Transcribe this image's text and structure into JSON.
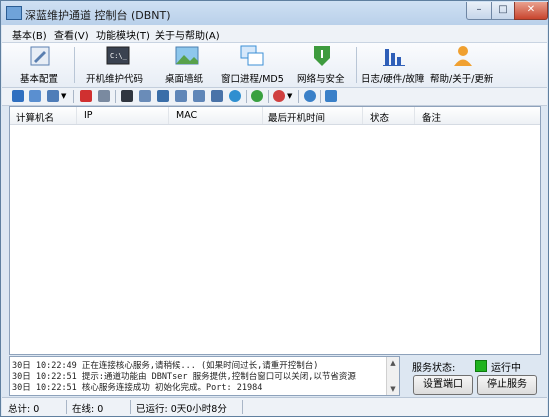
{
  "window": {
    "title": "深蓝维护通道 控制台 (DBNT)"
  },
  "menu": [
    "基本(B)",
    "查看(V)",
    "功能模块(T)",
    "关于与帮助(A)"
  ],
  "toolbar": [
    {
      "label": "基本配置",
      "icon": "settings-icon",
      "color": "#5a7fb0"
    },
    {
      "label": "开机维护代码",
      "icon": "terminal-icon",
      "color": "#3a4250"
    },
    {
      "label": "桌面墙纸",
      "icon": "wallpaper-icon",
      "color": "#58a14b"
    },
    {
      "label": "窗口进程/MD5",
      "icon": "windows-icon",
      "color": "#3b8fd6"
    },
    {
      "label": "网络与安全",
      "icon": "shield-icon",
      "color": "#3e9b3e"
    },
    {
      "label": "日志/硬件/故障",
      "icon": "bar-chart-icon",
      "color": "#2f5fb8"
    },
    {
      "label": "帮助/关于/更新",
      "icon": "user-icon",
      "color": "#f0a030"
    }
  ],
  "small_tools": [
    {
      "icon": "search-icon",
      "color": "#2f6fc0"
    },
    {
      "icon": "export-icon",
      "color": "#5a8fd0"
    },
    {
      "icon": "grid-view-icon",
      "color": "#4f7db8"
    },
    {
      "icon": "delete-icon",
      "color": "#d03030"
    },
    {
      "icon": "document-icon",
      "color": "#7a8aa0"
    },
    {
      "icon": "console-icon",
      "color": "#30363f"
    },
    {
      "icon": "mail-icon",
      "color": "#6a8cb8"
    },
    {
      "icon": "screen-icon",
      "color": "#3a6ea8"
    },
    {
      "icon": "window-icon",
      "color": "#5f86b8"
    },
    {
      "icon": "copy-window-icon",
      "color": "#5f86b8"
    },
    {
      "icon": "user-icon",
      "color": "#4a73a8"
    },
    {
      "icon": "eye-icon",
      "color": "#2f8fd0"
    },
    {
      "icon": "refresh-icon",
      "color": "#39a040"
    },
    {
      "icon": "stop-icon",
      "color": "#d04040"
    },
    {
      "icon": "clock-icon",
      "color": "#3a80c8"
    },
    {
      "icon": "calendar-icon",
      "color": "#3a80c8"
    }
  ],
  "list": {
    "columns": [
      "计算机名",
      "IP",
      "MAC",
      "最后开机时间",
      "状态",
      "备注"
    ],
    "rows": []
  },
  "log": [
    "30日 10:22:49 正在连接核心服务,请稍候... (如果时间过长,请重开控制台)",
    "30日 10:22:51 提示:通道功能由 DBNTser 服务提供,控制台窗口可以关闭,以节省资源",
    "30日 10:22:51 核心服务连接成功 初始化完成。Port: 21984"
  ],
  "service": {
    "status_label": "服务状态:",
    "status_value": "运行中",
    "status_color": "#1fb31f",
    "btn_port": "设置端口",
    "btn_stop": "停止服务"
  },
  "statusbar": {
    "total": "总计: 0",
    "online": "在线: 0",
    "uptime": "已运行: 0天0小时8分"
  }
}
